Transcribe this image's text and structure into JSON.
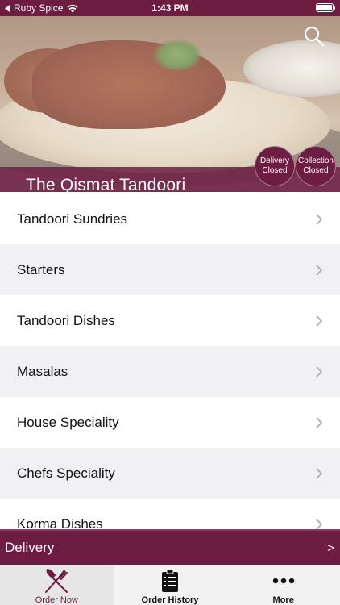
{
  "status_bar": {
    "back_app": "Ruby Spice",
    "time": "1:43 PM"
  },
  "header": {
    "restaurant_name": "The Qismat Tandoori",
    "delivery_badge": {
      "line1": "Delivery",
      "line2": "Closed"
    },
    "collection_badge": {
      "line1": "Collection",
      "line2": "Closed"
    }
  },
  "menu": {
    "categories": [
      {
        "label": "Tandoori Sundries"
      },
      {
        "label": "Starters"
      },
      {
        "label": "Tandoori Dishes"
      },
      {
        "label": "Masalas"
      },
      {
        "label": "House Speciality"
      },
      {
        "label": "Chefs Speciality"
      },
      {
        "label": "Korma Dishes"
      }
    ]
  },
  "order_mode": {
    "label": "Delivery",
    "arrow": ">"
  },
  "tabs": [
    {
      "label": "Order Now",
      "icon": "fork-knife-icon",
      "active": true
    },
    {
      "label": "Order History",
      "icon": "clipboard-icon",
      "active": false
    },
    {
      "label": "More",
      "icon": "more-dots-icon",
      "active": false
    }
  ],
  "colors": {
    "brand": "#6e1d42",
    "list_alt": "#f1f1f4"
  }
}
